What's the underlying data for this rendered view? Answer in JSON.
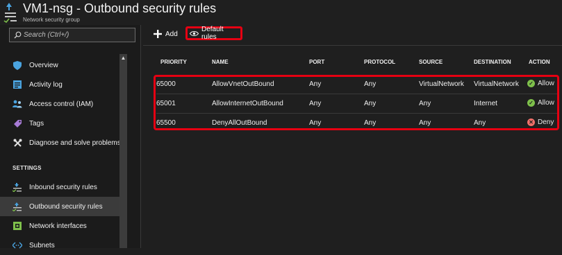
{
  "header": {
    "title": "VM1-nsg - Outbound security rules",
    "subtitle": "Network security group"
  },
  "search": {
    "placeholder": "Search (Ctrl+/)"
  },
  "sidebar": {
    "items": [
      {
        "label": "Overview",
        "icon": "shield-icon"
      },
      {
        "label": "Activity log",
        "icon": "activity-log-icon"
      },
      {
        "label": "Access control (IAM)",
        "icon": "users-icon"
      },
      {
        "label": "Tags",
        "icon": "tag-icon"
      },
      {
        "label": "Diagnose and solve problems",
        "icon": "wrench-icon"
      }
    ],
    "section_settings": "SETTINGS",
    "settings_items": [
      {
        "label": "Inbound security rules",
        "icon": "inbound-rules-icon"
      },
      {
        "label": "Outbound security rules",
        "icon": "outbound-rules-icon",
        "active": true
      },
      {
        "label": "Network interfaces",
        "icon": "network-interface-icon"
      },
      {
        "label": "Subnets",
        "icon": "subnet-icon"
      }
    ]
  },
  "toolbar": {
    "add_label": "Add",
    "default_rules_label": "Default rules"
  },
  "table": {
    "columns": [
      "PRIORITY",
      "NAME",
      "PORT",
      "PROTOCOL",
      "SOURCE",
      "DESTINATION",
      "ACTION"
    ],
    "rows": [
      {
        "priority": "65000",
        "name": "AllowVnetOutBound",
        "port": "Any",
        "protocol": "Any",
        "source": "VirtualNetwork",
        "destination": "VirtualNetwork",
        "action": "Allow"
      },
      {
        "priority": "65001",
        "name": "AllowInternetOutBound",
        "port": "Any",
        "protocol": "Any",
        "source": "Any",
        "destination": "Internet",
        "action": "Allow"
      },
      {
        "priority": "65500",
        "name": "DenyAllOutBound",
        "port": "Any",
        "protocol": "Any",
        "source": "Any",
        "destination": "Any",
        "action": "Deny"
      }
    ]
  },
  "colors": {
    "allow": "#7ec04b",
    "deny": "#f0706a",
    "highlight": "#e60012",
    "accent": "#4aa3df"
  }
}
